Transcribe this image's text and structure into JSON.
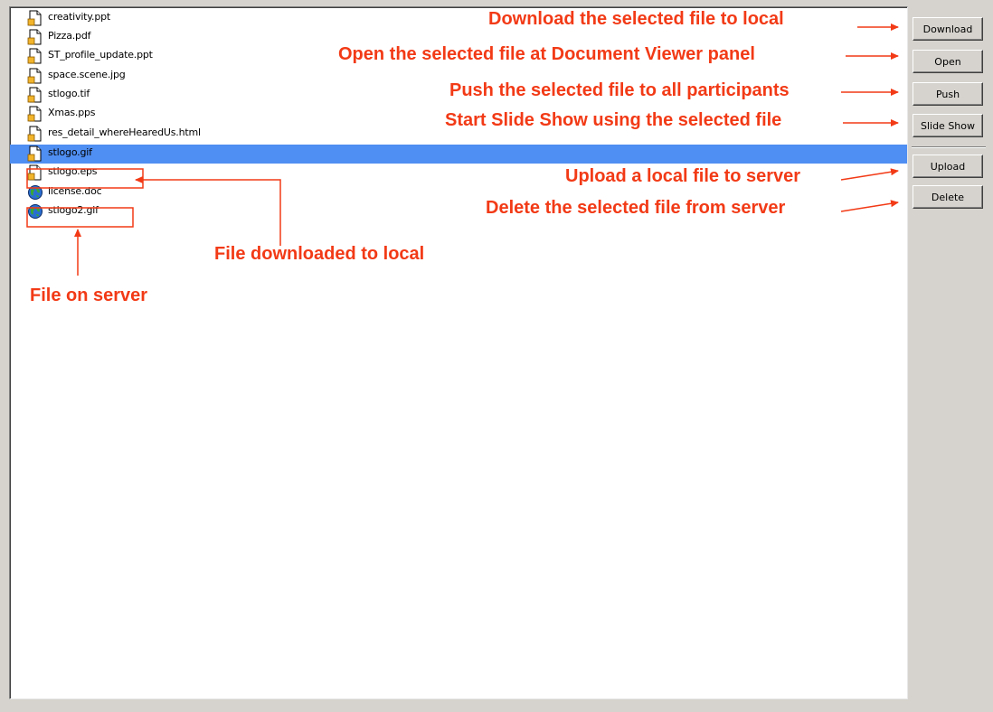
{
  "files": [
    {
      "name": "creativity.ppt",
      "icon": "document-icon",
      "selected": false
    },
    {
      "name": "Pizza.pdf",
      "icon": "document-icon",
      "selected": false
    },
    {
      "name": "ST_profile_update.ppt",
      "icon": "document-icon",
      "selected": false
    },
    {
      "name": "space.scene.jpg",
      "icon": "document-icon",
      "selected": false
    },
    {
      "name": "stlogo.tif",
      "icon": "document-icon",
      "selected": false
    },
    {
      "name": "Xmas.pps",
      "icon": "document-icon",
      "selected": false
    },
    {
      "name": "res_detail_whereHearedUs.html",
      "icon": "document-icon",
      "selected": false
    },
    {
      "name": "stlogo.gif",
      "icon": "document-icon",
      "selected": true
    },
    {
      "name": "stlogo.eps",
      "icon": "document-icon",
      "selected": false
    },
    {
      "name": "license.doc",
      "icon": "globe-icon",
      "selected": false
    },
    {
      "name": "stlogo2.gif",
      "icon": "globe-icon",
      "selected": false
    }
  ],
  "buttons": {
    "download": "Download",
    "open": "Open",
    "push": "Push",
    "slideshow": "Slide Show",
    "upload": "Upload",
    "delete": "Delete"
  },
  "annotations": {
    "download": "Download the selected file to local",
    "open": "Open the selected file at Document Viewer panel",
    "push": "Push the selected file to all participants",
    "slideshow": "Start Slide Show using the selected file",
    "upload": "Upload a local file to server",
    "delete": "Delete the selected file from server",
    "downloaded": "File downloaded to local",
    "server": "File on server"
  },
  "colors": {
    "annotation": "#f23a16",
    "selection": "#4f8ef2"
  }
}
